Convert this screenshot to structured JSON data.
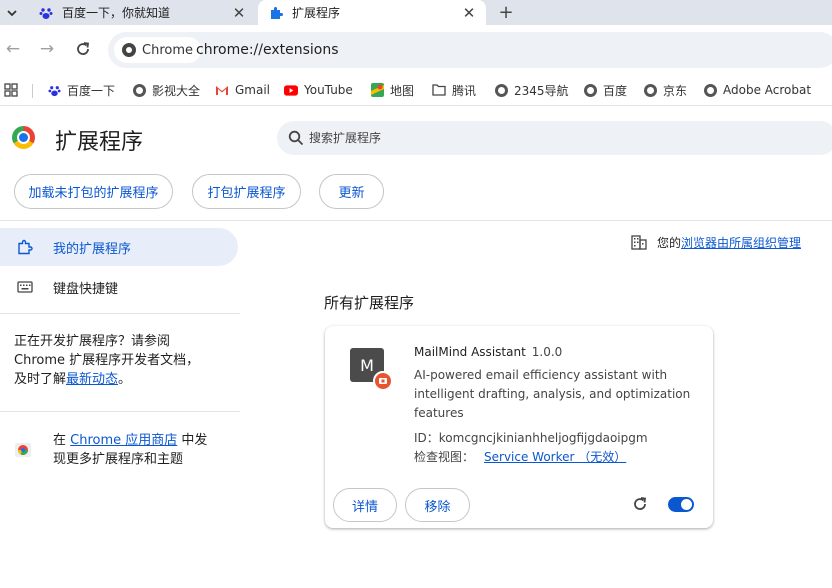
{
  "tabs": [
    {
      "title": "百度一下，你就知道",
      "icon": "baidu-paw-icon",
      "active": false
    },
    {
      "title": "扩展程序",
      "icon": "puzzle-icon",
      "active": true
    }
  ],
  "toolbar": {
    "chip_label": "Chrome",
    "url": "chrome://extensions"
  },
  "bookmarks": [
    {
      "label": "百度一下",
      "icon": "baidu-paw-icon"
    },
    {
      "label": "影视大全",
      "icon": "globe-icon"
    },
    {
      "label": "Gmail",
      "icon": "gmail-icon"
    },
    {
      "label": "YouTube",
      "icon": "youtube-icon"
    },
    {
      "label": "地图",
      "icon": "maps-icon"
    },
    {
      "label": "腾讯",
      "icon": "folder-icon"
    },
    {
      "label": "2345导航",
      "icon": "globe-icon"
    },
    {
      "label": "百度",
      "icon": "globe-icon"
    },
    {
      "label": "京东",
      "icon": "globe-icon"
    },
    {
      "label": "Adobe Acrobat",
      "icon": "globe-icon"
    }
  ],
  "header": {
    "title": "扩展程序",
    "search_placeholder": "搜索扩展程序"
  },
  "actions": {
    "load_unpacked": "加载未打包的扩展程序",
    "pack": "打包扩展程序",
    "update": "更新"
  },
  "sidebar": {
    "items": [
      {
        "label": "我的扩展程序",
        "selected": true
      },
      {
        "label": "键盘快捷键",
        "selected": false
      }
    ],
    "dev_text_1": "正在开发扩展程序？请参阅",
    "dev_text_2": "Chrome 扩展程序开发者文档，",
    "dev_text_3": "及时了解",
    "dev_link": "最新动态",
    "dev_text_end": "。",
    "store_prefix": "在 ",
    "store_link": "Chrome 应用商店",
    "store_suffix": " 中发",
    "store_line2": "现更多扩展程序和主题"
  },
  "managed": {
    "prefix": "您的",
    "link": "浏览器由所属组织管理"
  },
  "main": {
    "section_title": "所有扩展程序"
  },
  "extension": {
    "icon_letter": "M",
    "name": "MailMind Assistant",
    "version": "1.0.0",
    "description": "AI-powered email efficiency assistant with intelligent drafting, analysis, and optimization features",
    "id_label": "ID：",
    "id_value": "komcgncjkinianhheljogfijgdaoipgm",
    "views_label": "检查视图：",
    "views_link": "Service Worker （无效）",
    "details_button": "详情",
    "remove_button": "移除",
    "enabled": true
  },
  "colors": {
    "accent": "#0b57d0",
    "selected_bg": "#e8eef9",
    "tabstrip": "#dfe3eb"
  }
}
